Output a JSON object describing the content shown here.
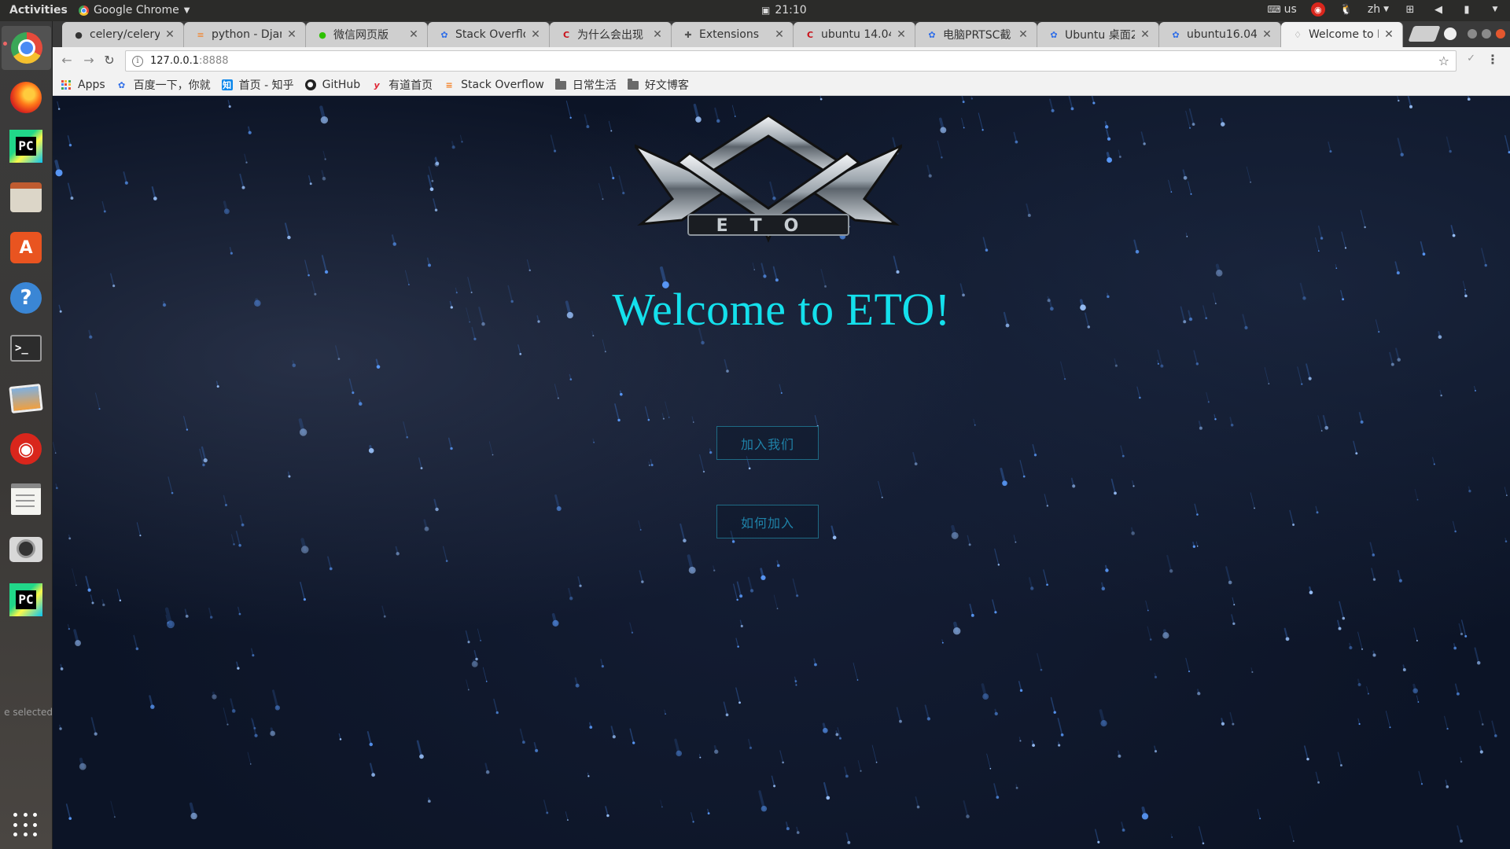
{
  "topbar": {
    "activities": "Activities",
    "app_name": "Google Chrome",
    "clock": "21:10",
    "keyboard": "us",
    "lang": "zh"
  },
  "launcher": {
    "apps": [
      "Chrome",
      "Firefox",
      "PyCharm",
      "Files",
      "Ubuntu Software",
      "Help",
      "Terminal",
      "Shotwell",
      "NetEase Cloud Music",
      "Text Editor",
      "Screenshot",
      "PyCharm"
    ],
    "selected_text": "e selected"
  },
  "tabs": [
    {
      "title": "celery/celery:",
      "icon": "github-icon"
    },
    {
      "title": "python - Djan",
      "icon": "stackoverflow-icon"
    },
    {
      "title": "微信网页版",
      "icon": "wechat-icon"
    },
    {
      "title": "Stack Overflo",
      "icon": "baidu-icon"
    },
    {
      "title": "为什么会出现",
      "icon": "csdn-icon"
    },
    {
      "title": "Extensions",
      "icon": "puzzle-icon"
    },
    {
      "title": "ubuntu 14.04",
      "icon": "csdn-icon"
    },
    {
      "title": "电脑PRTSC截",
      "icon": "baidu-icon"
    },
    {
      "title": "Ubuntu 桌面2",
      "icon": "baidu-icon"
    },
    {
      "title": "ubuntu16.04",
      "icon": "baidu-icon"
    },
    {
      "title": "Welcome to E",
      "icon": "eto-icon",
      "active": true
    }
  ],
  "omnibox": {
    "host": "127.0.0.1",
    "port": ":8888"
  },
  "bookmarks": [
    {
      "label": "Apps",
      "icon": "apps-grid-icon"
    },
    {
      "label": "百度一下，你就",
      "icon": "baidu-icon"
    },
    {
      "label": "首页 - 知乎",
      "icon": "zhihu-icon"
    },
    {
      "label": "GitHub",
      "icon": "github-icon"
    },
    {
      "label": "有道首页",
      "icon": "youdao-icon"
    },
    {
      "label": "Stack Overflow",
      "icon": "stackoverflow-icon"
    },
    {
      "label": "日常生活",
      "icon": "folder-icon"
    },
    {
      "label": "好文博客",
      "icon": "folder-icon"
    }
  ],
  "page": {
    "logo_text": "ETO",
    "headline": "Welcome to ETO!",
    "join_label": "加入我们",
    "how_label": "如何加入"
  },
  "colors": {
    "headline": "#14e0ec",
    "button_text": "#1f82a8",
    "button_border": "#1e6a84",
    "background": "#0c1426"
  }
}
